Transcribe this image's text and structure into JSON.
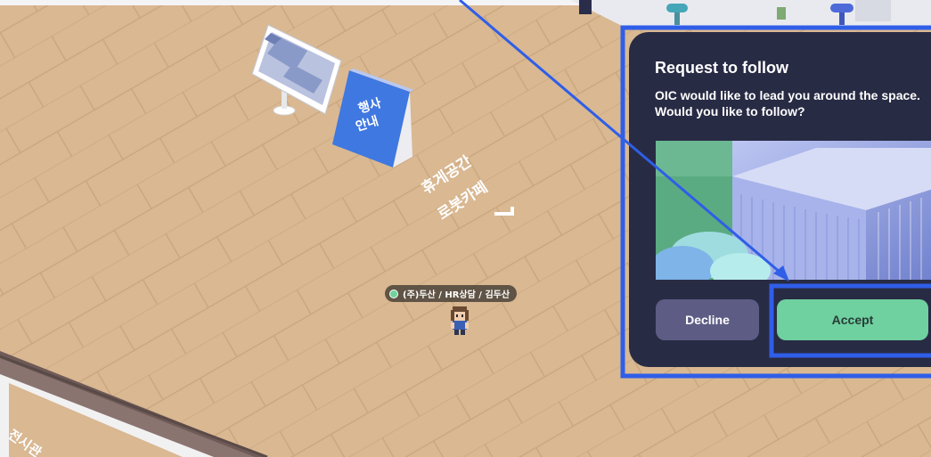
{
  "map": {
    "event_sign": "행사 안내",
    "event_sign_lines": [
      "행사",
      "안내"
    ],
    "floor_label_lines": [
      "휴게공간",
      "로봇카페"
    ],
    "corner_label": "전시관"
  },
  "player": {
    "name_tag": "(주)두산 / HR상담 / 김두산",
    "status_color": "#6fd19b"
  },
  "dialog": {
    "title": "Request to follow",
    "message_line1": "OIC would like to lead you around the space.",
    "message_line2": "Would you like to follow?",
    "decline_label": "Decline",
    "accept_label": "Accept"
  },
  "colors": {
    "floor": "#d9b892",
    "dialog_bg": "#282b44",
    "decline_bg": "#5d5c84",
    "accept_bg": "#6fd0a0",
    "highlight": "#2f5ee8"
  }
}
